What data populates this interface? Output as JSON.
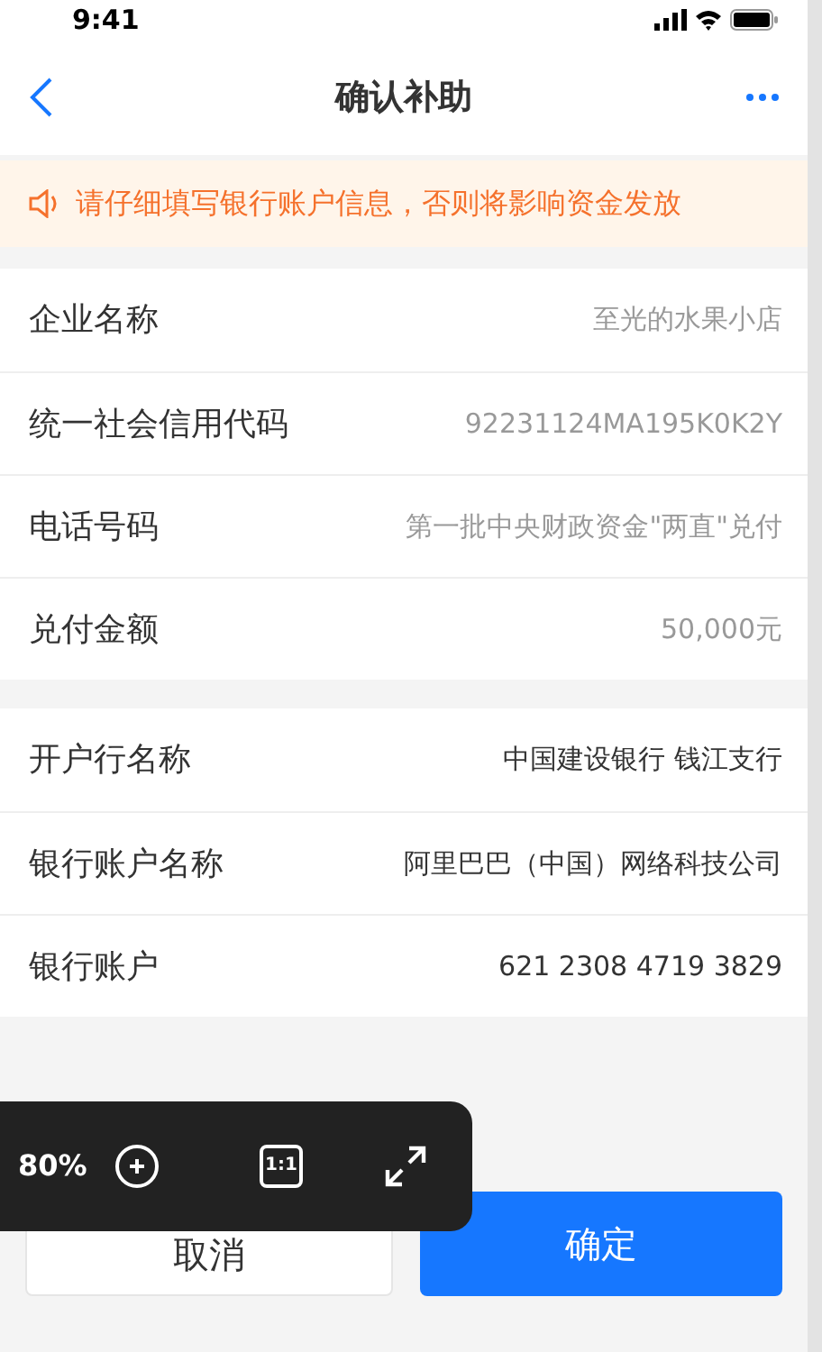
{
  "status_bar": {
    "time": "9:41"
  },
  "nav": {
    "title": "确认补助"
  },
  "notice": {
    "text": "请仔细填写银行账户信息，否则将影响资金发放"
  },
  "sections": [
    {
      "muted": true,
      "rows": [
        {
          "label": "企业名称",
          "value": "至光的水果小店"
        },
        {
          "label": "统一社会信用代码",
          "value": "92231124MA195K0K2Y"
        },
        {
          "label": "电话号码",
          "value": "第一批中央财政资金\"两直\"兑付"
        },
        {
          "label": "兑付金额",
          "value": "50,000元"
        }
      ]
    },
    {
      "muted": false,
      "rows": [
        {
          "label": "开户行名称",
          "value": "中国建设银行 钱江支行"
        },
        {
          "label": "银行账户名称",
          "value": "阿里巴巴（中国）网络科技公司"
        },
        {
          "label": "银行账户",
          "value": "621 2308 4719 3829"
        }
      ]
    }
  ],
  "buttons": [
    {
      "label": "取消",
      "kind": "secondary"
    },
    {
      "label": "确定",
      "kind": "primary"
    }
  ],
  "zoom_toolbar": {
    "zoom": "80%",
    "actual_size": "1:1"
  }
}
